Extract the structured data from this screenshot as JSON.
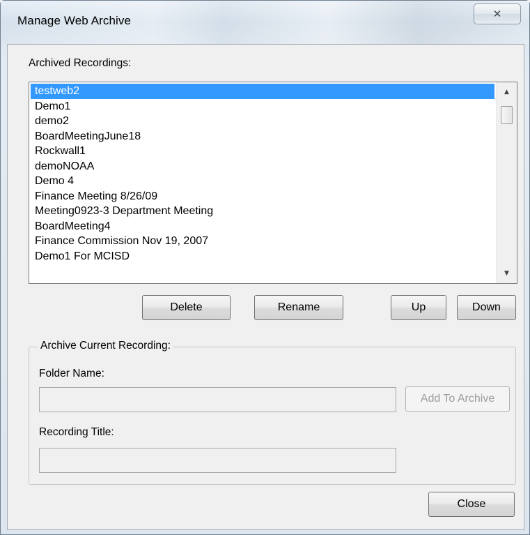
{
  "window": {
    "title": "Manage Web Archive",
    "close_glyph": "✕"
  },
  "list_section": {
    "label": "Archived Recordings:",
    "items": [
      "testweb2",
      "Demo1",
      "demo2",
      "BoardMeetingJune18",
      "Rockwall1",
      "demoNOAA",
      "Demo 4",
      "Finance Meeting 8/26/09",
      "Meeting0923-3 Department Meeting",
      "BoardMeeting4",
      "Finance Commission Nov 19, 2007",
      "Demo1 For MCISD"
    ],
    "selected_index": 0,
    "scroll_up_glyph": "▲",
    "scroll_down_glyph": "▼"
  },
  "list_buttons": {
    "delete": "Delete",
    "rename": "Rename",
    "up": "Up",
    "down": "Down"
  },
  "archive_group": {
    "legend": "Archive Current Recording:",
    "folder_label": "Folder Name:",
    "folder_value": "",
    "add_button": "Add To Archive",
    "title_label": "Recording Title:",
    "title_value": ""
  },
  "footer": {
    "close": "Close"
  },
  "colors": {
    "selection": "#3399ff",
    "client_bg": "#f0f0f0",
    "disabled_text": "#9d9d9d"
  }
}
